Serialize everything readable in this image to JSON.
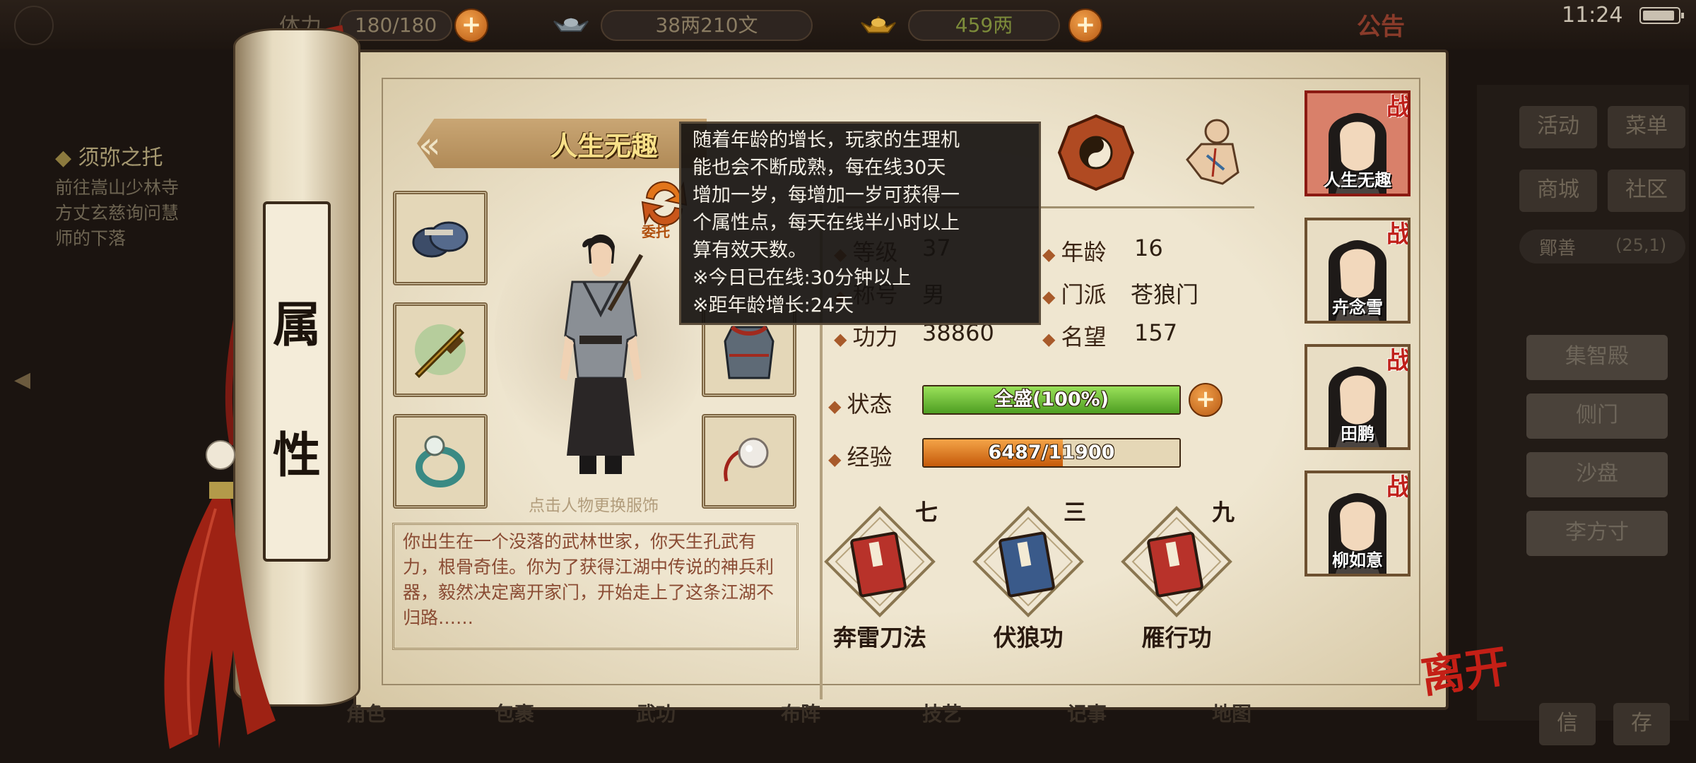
{
  "topbar": {
    "stamina_label": "体力",
    "stamina_value": "180/180",
    "silver_value": "38两210文",
    "gold_value": "459两",
    "notice_label": "公告",
    "clock": "11:24"
  },
  "quest": {
    "title": "须弥之托",
    "description": "前往嵩山少林寺\n方丈玄慈询问慧\n师的下落"
  },
  "scroll": {
    "chars": [
      "属",
      "性"
    ]
  },
  "character": {
    "name": "人生无趣",
    "entrust_label": "委托",
    "hint": "点击人物更换服饰",
    "bio": "你出生在一个没落的武林世家，你天生孔武有力，根骨奇佳。你为了获得江湖中传说的神兵利器，毅然决定离开家门，开始走上了这条江湖不归路……"
  },
  "stats": {
    "level_label": "等级",
    "level_value": "37",
    "age_label": "年龄",
    "age_value": "16",
    "title_label": "称号",
    "title_value": "男",
    "sect_label": "门派",
    "sect_value": "苍狼门",
    "power_label": "功力",
    "power_value": "38860",
    "fame_label": "名望",
    "fame_value": "157",
    "status_label": "状态",
    "status_text": "全盛(100%)",
    "status_fraction": 1.0,
    "exp_label": "经验",
    "exp_text": "6487/11900",
    "exp_fraction": 0.545
  },
  "tooltip": {
    "lines": [
      "随着年龄的增长，玩家的生理机",
      "能也会不断成熟，每在线30天",
      "增加一岁，每增加一岁可获得一",
      "个属性点，每天在线半小时以上",
      "算有效天数。",
      "※今日已在线:30分钟以上",
      "※距年龄增长:24天"
    ]
  },
  "skills": [
    {
      "name": "奔雷刀法",
      "level": "七",
      "color": "#b8322a"
    },
    {
      "name": "伏狼功",
      "level": "三",
      "color": "#3a5a8a"
    },
    {
      "name": "雁行功",
      "level": "九",
      "color": "#b8322a"
    }
  ],
  "roster": [
    {
      "name": "人生无趣",
      "badge": "战"
    },
    {
      "name": "卉念雪",
      "badge": "战"
    },
    {
      "name": "田鹏",
      "badge": "战"
    },
    {
      "name": "柳如意",
      "badge": "战"
    }
  ],
  "side_menu": {
    "activity": "活动",
    "menu": "菜单",
    "shop": "商城",
    "community": "社区",
    "location": "鄮善",
    "coords": "(25,1)",
    "rows": [
      "集智殿",
      "侧门",
      "沙盘",
      "李方寸"
    ],
    "bottom_left": "信",
    "bottom_right": "存"
  },
  "leave_label": "离开",
  "bottom_nav": [
    "角色",
    "包裹",
    "武功",
    "布阵",
    "技艺",
    "记事",
    "地图"
  ],
  "colors": {
    "status_bar": "#6cc23a",
    "exp_bar": "#e07a18",
    "accent_red": "#c0201a"
  }
}
